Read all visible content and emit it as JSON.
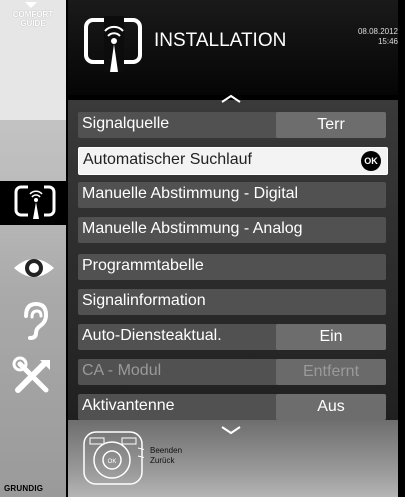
{
  "sidebar": {
    "comfort_guide": [
      "COMFORT",
      "GUIDE"
    ],
    "brand": "GRUNDIG",
    "icons": [
      "installation-icon",
      "eye-icon",
      "ear-icon",
      "tools-icon"
    ]
  },
  "header": {
    "title": "INSTALLATION",
    "date": "08.08.2012",
    "time": "15:46"
  },
  "menu": {
    "items": [
      {
        "label": "Signalquelle",
        "value": "Terr"
      },
      {
        "label": "Automatischer Suchlauf",
        "ok": "OK"
      },
      {
        "label": "Manuelle Abstimmung - Digital"
      },
      {
        "label": "Manuelle Abstimmung - Analog"
      },
      {
        "label": "Programmtabelle"
      },
      {
        "label": "Signalinformation"
      },
      {
        "label": "Auto-Diensteaktual.",
        "value": "Ein"
      },
      {
        "label": "CA - Modul",
        "value": "Entfernt"
      },
      {
        "label": "Aktivantenne",
        "value": "Aus"
      }
    ]
  },
  "footer": {
    "legend": [
      "Beenden",
      "Zurück"
    ],
    "remote_center": "OK"
  },
  "colors": {
    "row_bg": "#515151",
    "value_bg": "#6d6d6d",
    "selected_bg": "#f3f3f3"
  }
}
